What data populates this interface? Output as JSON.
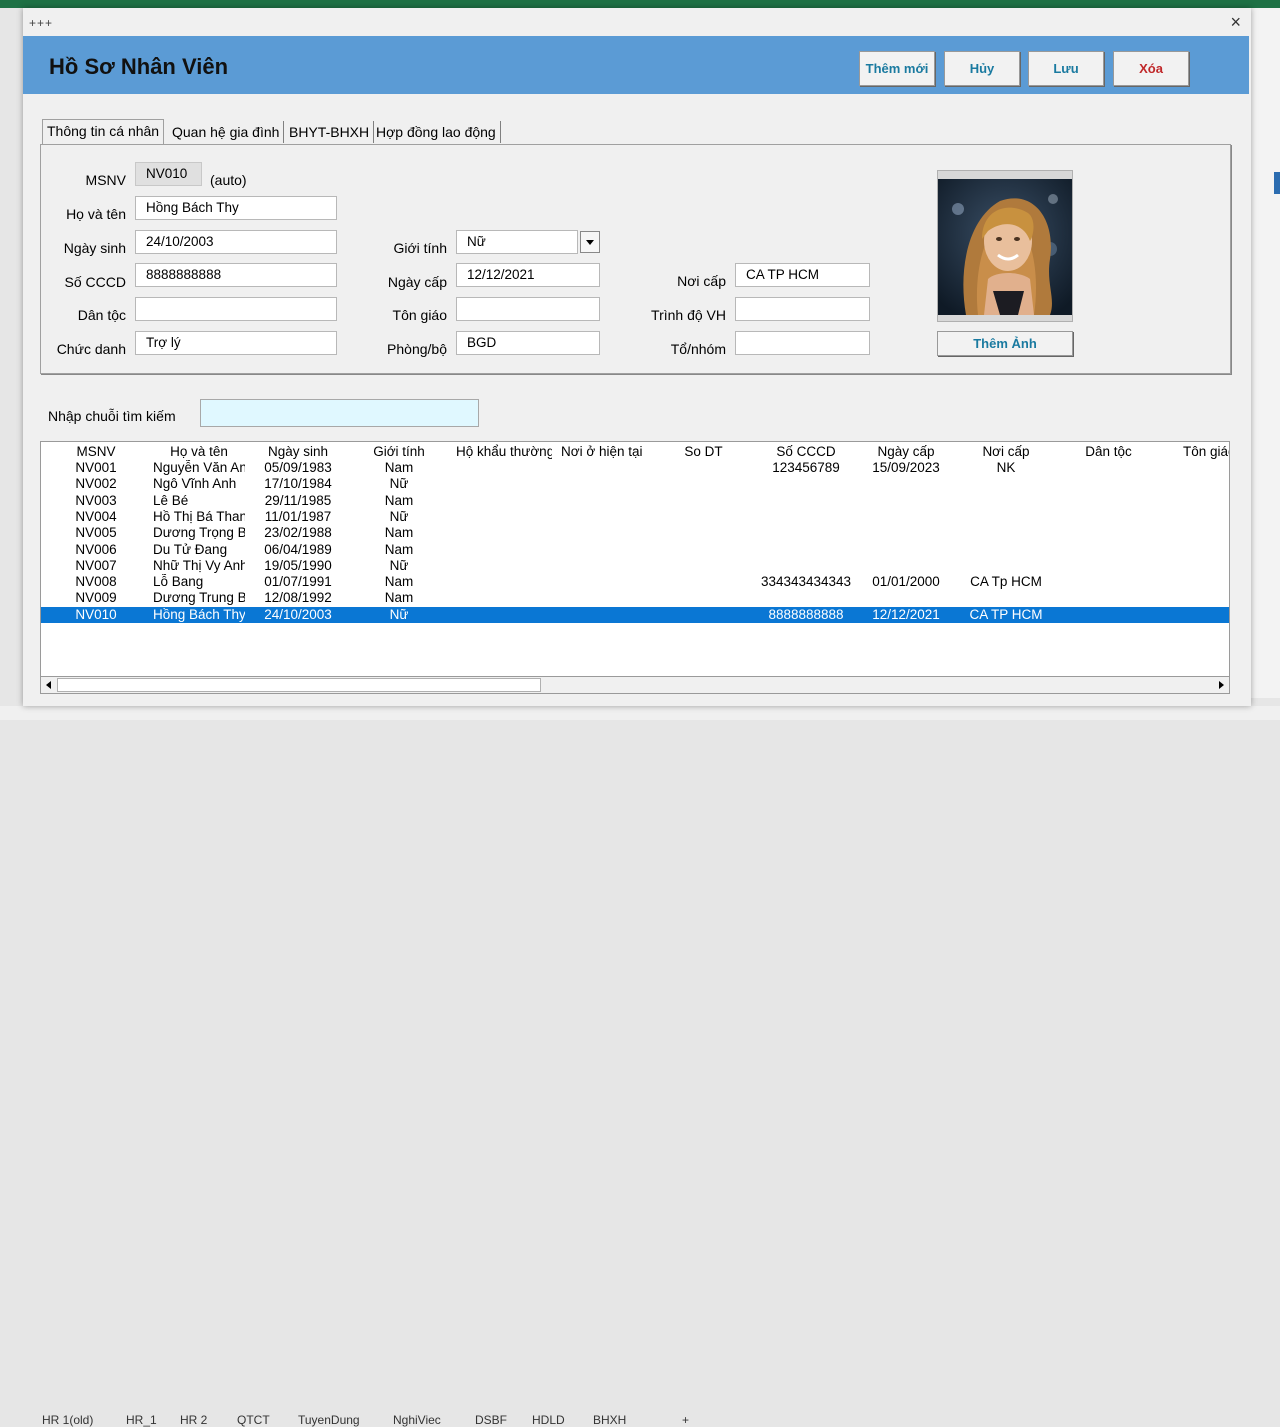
{
  "sheet_tabs": [
    "HR 1(old)",
    "HR_1",
    "HR 2",
    "QTCT",
    "TuyenDung",
    "NghiViec",
    "DSBF",
    "HDLD",
    "BHXH",
    "+"
  ],
  "dialog": {
    "title_glyph": "+++",
    "close_glyph": "×",
    "heading": "Hồ Sơ Nhân Viên",
    "buttons": {
      "add": "Thêm mới",
      "cancel": "Hủy",
      "save": "Lưu",
      "delete": "Xóa"
    }
  },
  "tabs": [
    "Thông tin cá nhân",
    "Quan hệ gia đình",
    "BHYT-BHXH",
    "Hợp đồng lao động"
  ],
  "form": {
    "msnv": {
      "label": "MSNV",
      "value": "NV010",
      "note": "(auto)"
    },
    "ho_ten": {
      "label": "Họ và tên",
      "value": "Hồng Bách Thy"
    },
    "ngay_sinh": {
      "label": "Ngày sinh",
      "value": "24/10/2003"
    },
    "so_cccd": {
      "label": "Số CCCD",
      "value": "8888888888"
    },
    "dan_toc": {
      "label": "Dân tộc",
      "value": ""
    },
    "chuc_danh": {
      "label": "Chức danh",
      "value": "Trợ lý"
    },
    "gioi_tinh": {
      "label": "Giới tính",
      "value": "Nữ"
    },
    "ngay_cap": {
      "label": "Ngày cấp",
      "value": "12/12/2021"
    },
    "ton_giao": {
      "label": "Tôn giáo",
      "value": ""
    },
    "phong_bo": {
      "label": "Phòng/bộ",
      "value": "BGD"
    },
    "noi_cap": {
      "label": "Nơi cấp",
      "value": "CA TP HCM"
    },
    "trinh_do": {
      "label": "Trình độ VH",
      "value": ""
    },
    "to_nhom": {
      "label": "Tổ/nhóm",
      "value": ""
    },
    "add_photo": "Thêm Ảnh"
  },
  "search": {
    "label": "Nhập chuỗi tìm kiếm",
    "value": ""
  },
  "table": {
    "headers": [
      "MSNV",
      "Họ và tên",
      "Ngày sinh",
      "Giới tính",
      "Hộ khẩu thường",
      "Nơi ở hiện tại",
      "So DT",
      "Số CCCD",
      "Ngày cấp",
      "Nơi cấp",
      "Dân tộc",
      "Tôn giáo"
    ],
    "rows": [
      [
        "NV001",
        "Nguyễn Văn An",
        "05/09/1983",
        "Nam",
        "",
        "",
        "",
        "123456789",
        "15/09/2023",
        "NK",
        "",
        ""
      ],
      [
        "NV002",
        "Ngô Vĩnh Anh",
        "17/10/1984",
        "Nữ",
        "",
        "",
        "",
        "",
        "",
        "",
        "",
        ""
      ],
      [
        "NV003",
        "Lê Bé",
        "29/11/1985",
        "Nam",
        "",
        "",
        "",
        "",
        "",
        "",
        "",
        ""
      ],
      [
        "NV004",
        "Hồ Thị  Bá Thanh",
        "11/01/1987",
        "Nữ",
        "",
        "",
        "",
        "",
        "",
        "",
        "",
        ""
      ],
      [
        "NV005",
        "Dương Trọng Bảo",
        "23/02/1988",
        "Nam",
        "",
        "",
        "",
        "",
        "",
        "",
        "",
        ""
      ],
      [
        "NV006",
        "Du Tử Đang",
        "06/04/1989",
        "Nam",
        "",
        "",
        "",
        "",
        "",
        "",
        "",
        ""
      ],
      [
        "NV007",
        "Nhữ Thị Vy Anh",
        "19/05/1990",
        "Nữ",
        "",
        "",
        "",
        "",
        "",
        "",
        "",
        ""
      ],
      [
        "NV008",
        "Lỗ Bang",
        "01/07/1991",
        "Nam",
        "",
        "",
        "",
        "334343434343",
        "01/01/2000",
        "CA Tp HCM",
        "",
        ""
      ],
      [
        "NV009",
        "Dương Trung Bảo",
        "12/08/1992",
        "Nam",
        "",
        "",
        "",
        "",
        "",
        "",
        "",
        ""
      ],
      [
        "NV010",
        "Hồng Bách Thy",
        "24/10/2003",
        "Nữ",
        "",
        "",
        "",
        "8888888888",
        "12/12/2021",
        "CA TP HCM",
        "",
        ""
      ]
    ],
    "selected_index": 9
  },
  "colors": {
    "banner": "#5b9bd5",
    "selection": "#0a77d4",
    "button_text": "#1a7aa0",
    "delete_text": "#c0282a",
    "search_bg": "#e0f8ff"
  }
}
